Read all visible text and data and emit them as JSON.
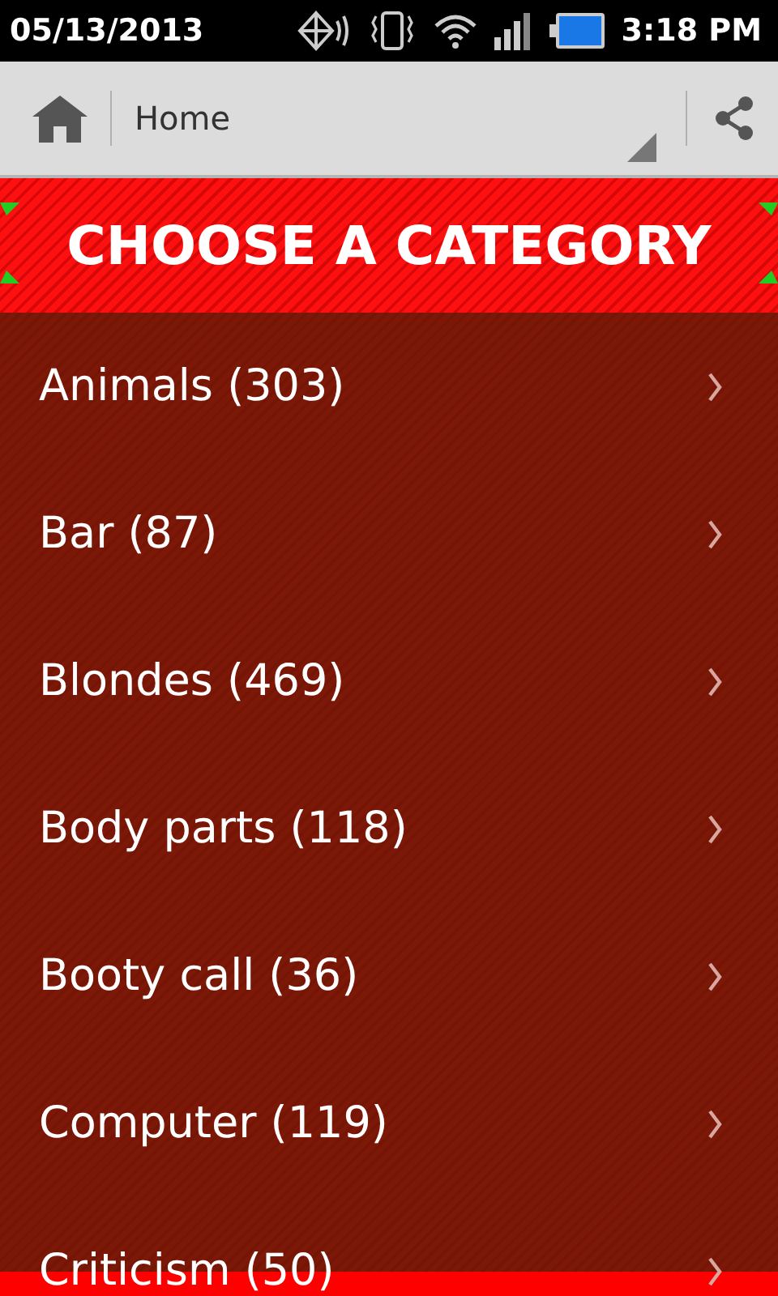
{
  "status_bar": {
    "date": "05/13/2013",
    "time": "3:18 PM"
  },
  "action_bar": {
    "title": "Home"
  },
  "header": {
    "title": "CHOOSE A CATEGORY"
  },
  "categories": [
    {
      "label": "Animals (303)"
    },
    {
      "label": "Bar (87)"
    },
    {
      "label": "Blondes (469)"
    },
    {
      "label": "Body parts (118)"
    },
    {
      "label": "Booty call (36)"
    },
    {
      "label": "Computer (119)"
    },
    {
      "label": "Criticism (50)"
    }
  ]
}
